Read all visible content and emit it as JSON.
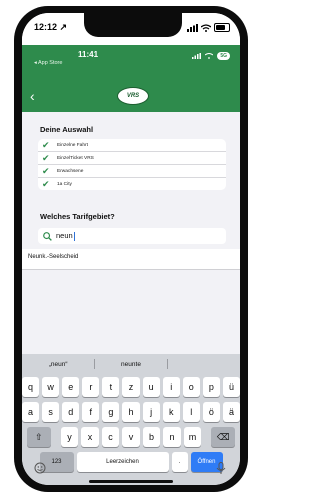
{
  "outer_status": {
    "time": "12:12",
    "location_glyph": "↗"
  },
  "inner_status": {
    "time": "11:41",
    "back_app": "◂ App Store",
    "network_badge": "5G"
  },
  "header": {
    "back_glyph": "‹",
    "logo_text": "VRS"
  },
  "selection": {
    "title": "Deine Auswahl",
    "items": [
      {
        "label": "Einzelne Fahrt"
      },
      {
        "label": "EinzelTicket VRS"
      },
      {
        "label": "Erwachsene"
      },
      {
        "label": "1a City"
      }
    ]
  },
  "tarif": {
    "title": "Welches Tarifgebiet?"
  },
  "search": {
    "value": "neun",
    "icon": "search-icon"
  },
  "results": [
    {
      "label": "Neunk.-Seelscheid"
    }
  ],
  "keyboard": {
    "suggestions": [
      "„neun“",
      "neunte",
      ""
    ],
    "row1": [
      "q",
      "w",
      "e",
      "r",
      "t",
      "z",
      "u",
      "i",
      "o",
      "p",
      "ü"
    ],
    "row2": [
      "a",
      "s",
      "d",
      "f",
      "g",
      "h",
      "j",
      "k",
      "l",
      "ö",
      "ä"
    ],
    "row3": [
      "y",
      "x",
      "c",
      "v",
      "b",
      "n",
      "m"
    ],
    "shift_glyph": "⇧",
    "delete_glyph": "⌫",
    "numbers_label": "123",
    "space_label": "Leerzeichen",
    "period_label": ".",
    "go_label": "Öffnen"
  },
  "colors": {
    "brand_green": "#2e8b4c",
    "go_blue": "#2f7cf6"
  }
}
